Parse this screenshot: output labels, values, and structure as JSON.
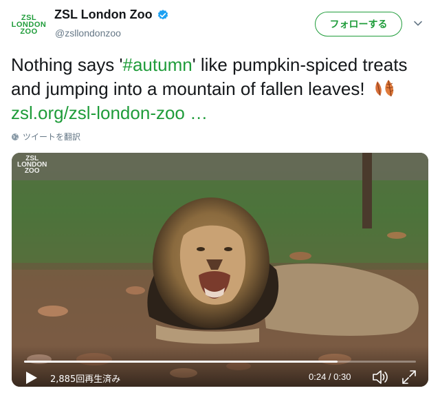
{
  "account": {
    "avatar_lines": [
      "ZSL",
      "LONDON",
      "ZOO"
    ],
    "display_name": "ZSL London Zoo",
    "handle": "@zsllondonzoo",
    "verified": true,
    "follow_label": "フォローする"
  },
  "tweet": {
    "text_before": "Nothing says '",
    "hashtag": "#autumn",
    "text_middle": "' like pumpkin-spiced treats and jumping into a mountain of fallen leaves!",
    "link": "zsl.org/zsl-london-zoo …",
    "emoji_icon": "fallen-leaves-icon",
    "translate_label": "ツイートを翻訳"
  },
  "video": {
    "watermark_lines": [
      "ZSL",
      "LONDON",
      "ZOO"
    ],
    "views": "2,885回再生済み",
    "time": "0:24 / 0:30",
    "progress_fraction": 0.8
  },
  "colors": {
    "brand_green": "#1f9c3a",
    "verified_blue": "#1da1f2",
    "text_primary": "#14171a",
    "text_secondary": "#657786"
  }
}
